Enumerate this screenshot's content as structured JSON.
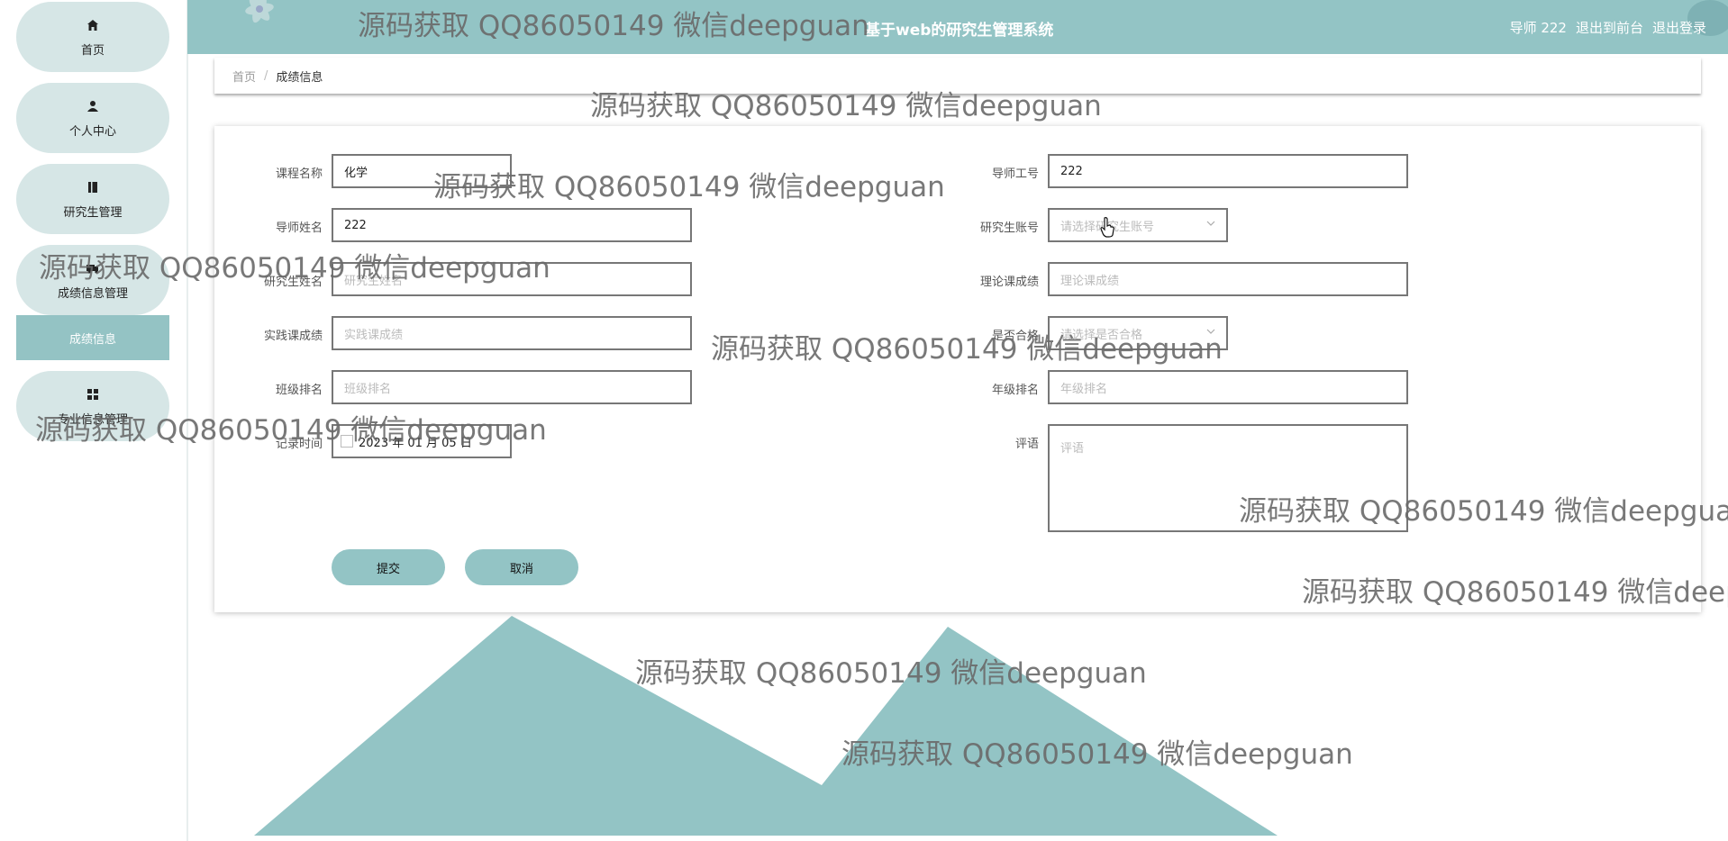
{
  "header": {
    "title": "基于web的研究生管理系统",
    "user": "导师 222",
    "exit_front": "退出到前台",
    "logout": "退出登录"
  },
  "sidebar": {
    "items": [
      {
        "label": "首页",
        "icon": "home-icon"
      },
      {
        "label": "个人中心",
        "icon": "user-icon"
      },
      {
        "label": "研究生管理",
        "icon": "book-icon"
      },
      {
        "label": "成绩信息管理",
        "icon": "truck-icon"
      },
      {
        "label": "专业信息管理",
        "icon": "grid-icon"
      }
    ],
    "active_sub": "成绩信息"
  },
  "breadcrumb": {
    "home": "首页",
    "sep": "/",
    "current": "成绩信息"
  },
  "form": {
    "course_name": {
      "label": "课程名称",
      "value": "化学"
    },
    "teacher_id": {
      "label": "导师工号",
      "value": "222"
    },
    "teacher_name": {
      "label": "导师姓名",
      "value": "222"
    },
    "student_account": {
      "label": "研究生账号",
      "placeholder": "请选择研究生账号"
    },
    "student_name": {
      "label": "研究生姓名",
      "placeholder": "研究生姓名"
    },
    "theory_score": {
      "label": "理论课成绩",
      "placeholder": "理论课成绩"
    },
    "practice_score": {
      "label": "实践课成绩",
      "placeholder": "实践课成绩"
    },
    "pass": {
      "label": "是否合格",
      "placeholder": "请选择是否合格"
    },
    "class_rank": {
      "label": "班级排名",
      "placeholder": "班级排名"
    },
    "grade_rank": {
      "label": "年级排名",
      "placeholder": "年级排名"
    },
    "record_time": {
      "label": "记录时间",
      "value": "2023 年 01 月 05 日"
    },
    "comment": {
      "label": "评语",
      "placeholder": "评语"
    },
    "submit": "提交",
    "cancel": "取消"
  },
  "watermark": "源码获取 QQ86050149 微信deepguan",
  "colors": {
    "accent": "#93c4c5",
    "pill": "#d6e6e6"
  }
}
